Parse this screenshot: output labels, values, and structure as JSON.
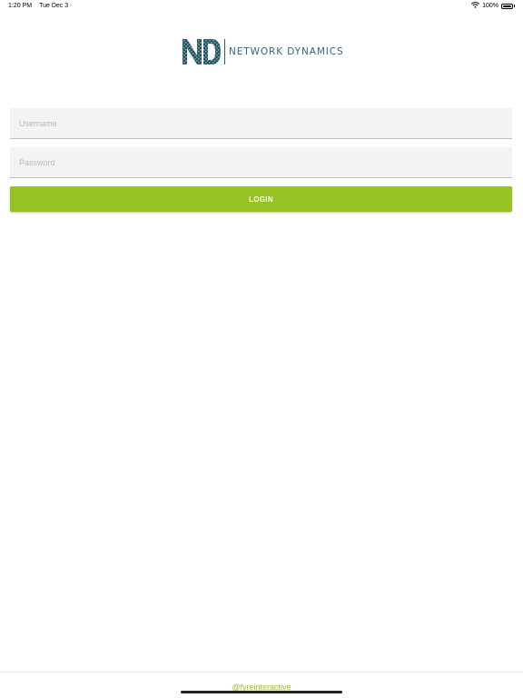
{
  "status_bar": {
    "time": "1:20 PM",
    "date": "Tue Dec 3",
    "battery": "100%",
    "icons": [
      "wifi-icon",
      "battery-icon"
    ]
  },
  "logo": {
    "mark_text": "ND",
    "name": "NETWORK DYNAMICS",
    "color": "#2f6a78"
  },
  "form": {
    "username_placeholder": "Username",
    "username_value": "",
    "password_placeholder": "Password",
    "password_value": "",
    "login_label": "LOGIN",
    "accent_color": "#97c225"
  },
  "footer": {
    "credit": "@fyreinteractive"
  }
}
